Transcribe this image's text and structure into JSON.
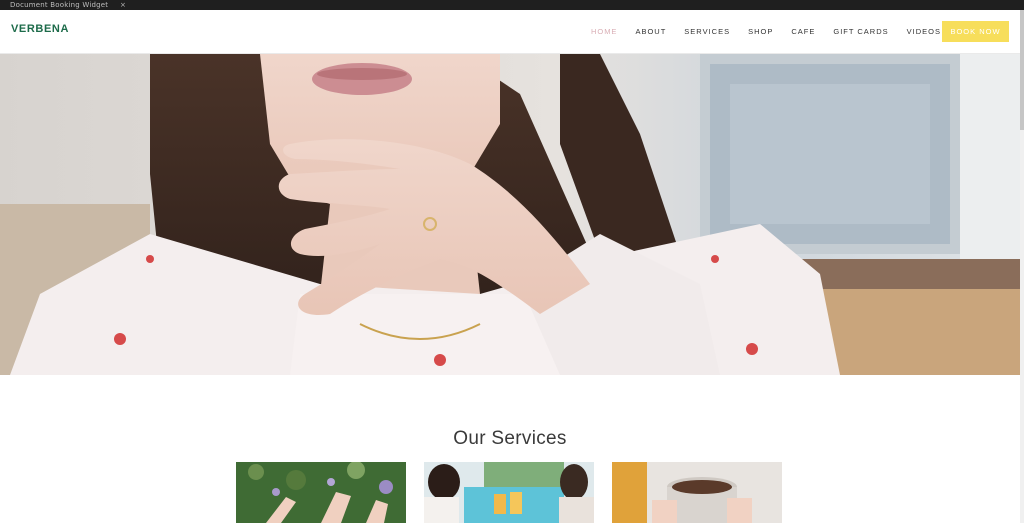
{
  "topbar": {
    "text": "Document Booking Widget",
    "close": "×"
  },
  "header": {
    "logo": "VERBENA",
    "nav": [
      "HOME",
      "ABOUT",
      "SERVICES",
      "SHOP",
      "CAFE",
      "GIFT CARDS",
      "VIDEOS"
    ],
    "active": "HOME",
    "cta": "BOOK NOW"
  },
  "colors": {
    "brand": "#1d6b4a",
    "cta": "#f7de5b",
    "active_nav": "#d9aeb5"
  },
  "services": {
    "title": "Our Services"
  }
}
